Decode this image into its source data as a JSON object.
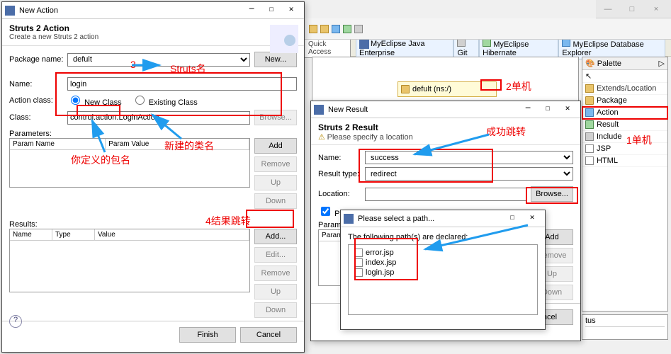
{
  "mainwin": {
    "min": "—",
    "max": "□",
    "close": "×"
  },
  "toolbar": {
    "quickAccess": "Quick Access",
    "persp1": "MyEclipse Java Enterprise",
    "persp2": "Git",
    "persp3": "MyEclipse Hibernate",
    "persp4": "MyEclipse Database Explorer"
  },
  "canvasNode": "defult (ns:/)",
  "palette": {
    "title": "Palette",
    "ext": "Extends/Location",
    "pkg": "Package",
    "action": "Action",
    "result": "Result",
    "include": "Include",
    "jsp": "JSP",
    "html": "HTML"
  },
  "newAction": {
    "winTitle": "New Action",
    "heading": "Struts 2 Action",
    "sub": "Create a new Struts 2 action",
    "lblPkg": "Package name:",
    "pkg": "defult",
    "btnNew": "New...",
    "lblName": "Name:",
    "name": "login",
    "lblActionClass": "Action class:",
    "radNew": "New Class",
    "radExisting": "Existing Class",
    "lblClass": "Class:",
    "classVal": "control.action.LoginAction",
    "btnBrowse": "Browse...",
    "secParams": "Parameters:",
    "colParamName": "Param Name",
    "colParamValue": "Param Value",
    "btnAdd": "Add",
    "btnRemove": "Remove",
    "btnUp": "Up",
    "btnDown": "Down",
    "secResults": "Results:",
    "colRName": "Name",
    "colRType": "Type",
    "colRValue": "Value",
    "btnAddR": "Add...",
    "btnEditR": "Edit...",
    "btnFinish": "Finish",
    "btnCancel": "Cancel"
  },
  "newResult": {
    "winTitle": "New Result",
    "heading": "Struts 2 Result",
    "warn": "Please specify a location",
    "lblName": "Name:",
    "name": "success",
    "lblType": "Result type:",
    "type": "redirect",
    "lblLoc": "Location:",
    "loc": "",
    "btnBrowse": "Browse...",
    "chkParams": "Params:",
    "secParams": "Parameters:",
    "colPa": "Param",
    "btnAdd": "Add",
    "btnRemove": "Remove",
    "btnUp": "Up",
    "btnDown": "Down",
    "btnCancel": "Cancel"
  },
  "pathDlg": {
    "winTitle": "Please select a path...",
    "desc": "The following path(s) are declared:",
    "items": [
      "error.jsp",
      "index.jsp",
      "login.jsp"
    ]
  },
  "annot": {
    "struts": "Struts名",
    "num3": "3",
    "newClass": "新建的类名",
    "yourPkg": "你定义的包名",
    "resultJump": "4结果跳转",
    "successJump": "成功跳转",
    "single2": "2单机",
    "single1": "1单机",
    "tus": "tus"
  }
}
